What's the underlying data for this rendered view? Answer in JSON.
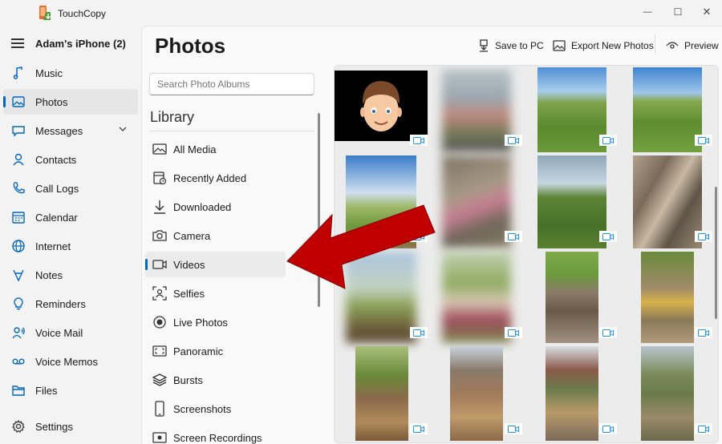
{
  "app": {
    "title": "TouchCopy"
  },
  "window": {
    "minimize": "—",
    "maximize": "☐",
    "close": "✕"
  },
  "nav": {
    "device": "Adam's iPhone (2)",
    "items": [
      {
        "label": "Music",
        "icon": "music-note-icon"
      },
      {
        "label": "Photos",
        "icon": "photo-icon",
        "active": true
      },
      {
        "label": "Messages",
        "icon": "chat-bubble-icon"
      },
      {
        "label": "Contacts",
        "icon": "person-icon"
      },
      {
        "label": "Call Logs",
        "icon": "phone-icon"
      },
      {
        "label": "Calendar",
        "icon": "calendar-icon"
      },
      {
        "label": "Internet",
        "icon": "globe-icon"
      },
      {
        "label": "Notes",
        "icon": "notes-icon"
      },
      {
        "label": "Reminders",
        "icon": "bulb-icon"
      },
      {
        "label": "Voice Mail",
        "icon": "voicemail-icon"
      },
      {
        "label": "Voice Memos",
        "icon": "tape-icon"
      },
      {
        "label": "Files",
        "icon": "folder-icon"
      },
      {
        "label": "Settings",
        "icon": "gear-icon"
      }
    ]
  },
  "page": {
    "title": "Photos"
  },
  "toolbar": {
    "save_to_pc": "Save to PC",
    "export_new": "Export New Photos",
    "preview": "Preview"
  },
  "albums": {
    "search_placeholder": "Search Photo Albums",
    "library_title": "Library",
    "items": [
      {
        "label": "All Media",
        "icon": "photo-icon"
      },
      {
        "label": "Recently Added",
        "icon": "calendar-clock-icon"
      },
      {
        "label": "Downloaded",
        "icon": "download-icon"
      },
      {
        "label": "Camera",
        "icon": "camera-icon"
      },
      {
        "label": "Videos",
        "icon": "video-icon",
        "active": true
      },
      {
        "label": "Selfies",
        "icon": "selfie-icon"
      },
      {
        "label": "Live Photos",
        "icon": "live-photo-icon"
      },
      {
        "label": "Panoramic",
        "icon": "panorama-icon"
      },
      {
        "label": "Bursts",
        "icon": "stack-icon"
      },
      {
        "label": "Screenshots",
        "icon": "phone-outline-icon"
      },
      {
        "label": "Screen Recordings",
        "icon": "screen-record-icon"
      }
    ]
  },
  "colors": {
    "accent": "#0067c0",
    "arrow": "#c00000",
    "video_badge": "#1e90ff"
  }
}
